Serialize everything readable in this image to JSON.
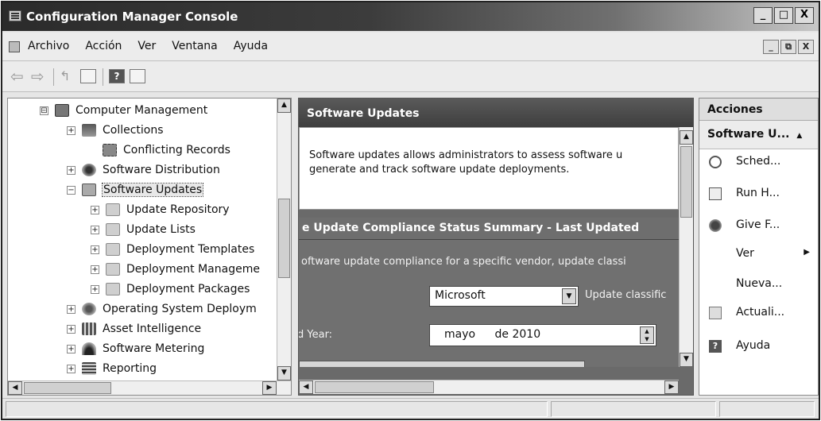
{
  "window": {
    "title": "Configuration Manager Console",
    "caption_buttons": [
      "_",
      "□",
      "X"
    ],
    "inner_buttons": [
      "_",
      "⧉",
      "X"
    ]
  },
  "menu": [
    "Archivo",
    "Acción",
    "Ver",
    "Ventana",
    "Ayuda"
  ],
  "toolbar": {
    "help_glyph": "?"
  },
  "tree": {
    "items": [
      {
        "label": "Computer Management",
        "exp": "⊟",
        "icon": "computer-management-icon"
      },
      {
        "label": "Collections",
        "exp": "+",
        "icon": "collections-icon"
      },
      {
        "label": "Conflicting Records",
        "exp": "",
        "icon": "conflicting-records-icon"
      },
      {
        "label": "Software Distribution",
        "exp": "+",
        "icon": "software-distribution-icon"
      },
      {
        "label": "Software Updates",
        "exp": "−",
        "icon": "software-updates-icon"
      },
      {
        "label": "Update Repository",
        "exp": "+",
        "icon": "folder-icon"
      },
      {
        "label": "Update Lists",
        "exp": "+",
        "icon": "folder-icon"
      },
      {
        "label": "Deployment Templates",
        "exp": "+",
        "icon": "folder-icon"
      },
      {
        "label": "Deployment Manageme",
        "exp": "+",
        "icon": "folder-icon"
      },
      {
        "label": "Deployment Packages",
        "exp": "+",
        "icon": "folder-icon"
      },
      {
        "label": "Operating System Deploym",
        "exp": "+",
        "icon": "os-deployment-icon"
      },
      {
        "label": "Asset Intelligence",
        "exp": "+",
        "icon": "asset-intelligence-icon"
      },
      {
        "label": "Software Metering",
        "exp": "+",
        "icon": "software-metering-icon"
      },
      {
        "label": "Reporting",
        "exp": "+",
        "icon": "reporting-icon"
      }
    ]
  },
  "center": {
    "header": "Software Updates",
    "description_line1": "Software updates allows administrators to assess software u",
    "description_line2": "generate and track software update deployments.",
    "section_title": "e Update Compliance Status Summary - Last Updated",
    "compliance_text": "oftware update compliance for a specific vendor, update classi",
    "vendor_value": "Microsoft",
    "classification_label": "Update classific",
    "year_label": "d Year:",
    "month_value": "mayo",
    "year_value": "de 2010"
  },
  "actions": {
    "header": "Acciones",
    "subheader": "Software U...",
    "items": [
      {
        "label": "Sched...",
        "icon": "clock-icon"
      },
      {
        "label": "Run H...",
        "icon": "run-hardware-icon"
      },
      {
        "label": "Give F...",
        "icon": "feedback-icon"
      },
      {
        "label": "Ver",
        "icon": ""
      },
      {
        "label": "Nueva...",
        "icon": ""
      },
      {
        "label": "Actuali...",
        "icon": "refresh-icon"
      },
      {
        "label": "Ayuda",
        "icon": "help-icon"
      }
    ]
  }
}
